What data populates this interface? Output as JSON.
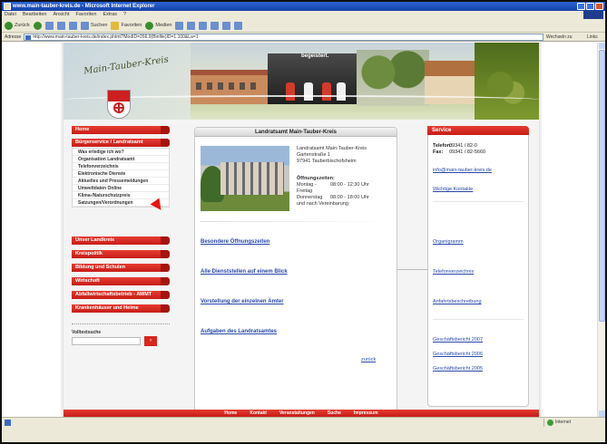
{
  "window": {
    "title": "www.main-tauber-kreis.de - Microsoft Internet Explorer"
  },
  "menubar": [
    "Datei",
    "Bearbeiten",
    "Ansicht",
    "Favoriten",
    "Extras",
    "?"
  ],
  "toolbar": {
    "back": "Zurück",
    "search": "Suchen",
    "favorites": "Favoriten",
    "media": "Medien"
  },
  "addressbar": {
    "label": "Adresse",
    "url": "http://www.main-tauber-kreis.de/index.phtml?ModID=266.9(Binfile)ID=1.100&La=1",
    "go": "Wechseln zu",
    "links": "Links"
  },
  "banner": {
    "script": "Main-Tauber-Kreis",
    "sport_label": "begeistert."
  },
  "nav": {
    "home": "Home",
    "buergerservice": "Bürgerservice / Landratsamt",
    "sub_items": [
      "Was erledige ich wo?",
      "Organisation Landratsamt",
      "Telefonverzeichnis",
      "Elektronische Dienste",
      "Aktuelles und Pressemeldungen",
      "Umweltdaten Online",
      "Klima-/Naturschutzpreis",
      "Satzungen/Verordnungen"
    ],
    "sections": [
      "Unser Landkreis",
      "Kreispolitik",
      "Bildung und Schulen",
      "Wirtschaft",
      "Abfallwirtschaftsbetrieb - AWMT",
      "Krankenhäuser und Heime"
    ],
    "quick_search_label": "Volltextsuche"
  },
  "center": {
    "title": "Landratsamt Main-Tauber-Kreis",
    "address_lines": [
      "Landratsamt Main-Tauber-Kreis",
      "Gartenstraße 1",
      "97941 Tauberbischofsheim"
    ],
    "hours_title": "Öffnungszeiten:",
    "hours": [
      {
        "days": "Montag - Freitag",
        "time": "08:00 - 12:30 Uhr"
      },
      {
        "days": "Donnerstag",
        "time": "08:00 - 18:00 Uhr"
      }
    ],
    "hours_note": "und nach Vereinbarung",
    "links": [
      "Besondere Öffnungszeiten",
      "Alle Dienststellen auf einem Blick",
      "Vorstellung der einzelnen Ämter",
      "Aufgaben des Landratsamtes"
    ],
    "back": "zurück"
  },
  "service": {
    "title": "Service",
    "phone_label": "Telefon:",
    "phone": "09341 / 82-0",
    "fax_label": "Fax:",
    "fax": "09341 / 82-5660",
    "email": "info@main-tauber-kreis.de",
    "links_top": [
      "Wichtige Kontakte"
    ],
    "links_mid": [
      "Organigramm",
      "Telefonverzeichnis",
      "Anfahrtsbeschreibung"
    ],
    "links_bottom": [
      "Geschäftsbericht 2007",
      "Geschäftsbericht 2006",
      "Geschäftsbericht 2005"
    ]
  },
  "footer": [
    "Home",
    "Kontakt",
    "Veranstaltungen",
    "Suche",
    "Impressum"
  ],
  "status": {
    "zone": "Internet"
  },
  "colors": {
    "accent_red": "#d9261c",
    "link_blue": "#2948a8"
  }
}
